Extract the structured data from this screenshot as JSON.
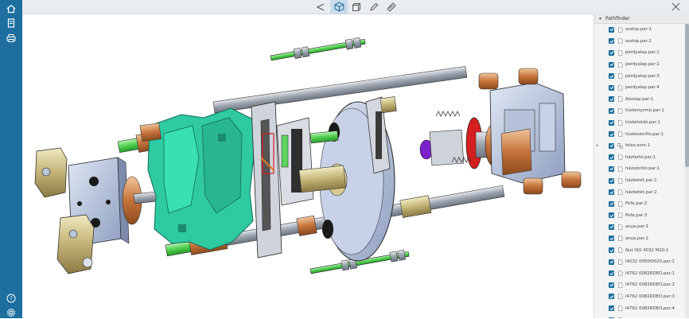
{
  "toolbar": {
    "icons": [
      "select-icon",
      "3d-view-icon",
      "cube-icon",
      "pen-icon",
      "measure-icon"
    ],
    "active": "3d-view-icon",
    "close_icon": "close-icon"
  },
  "sidebar": {
    "top_icons": [
      "home-icon",
      "document-icon",
      "printer-icon"
    ],
    "bottom_icons": [
      "help-icon",
      "settings-icon"
    ]
  },
  "zoom": {
    "level": 0.1
  },
  "pathfinder": {
    "title": "Pathfinder",
    "items": [
      {
        "label": "oszlop.par:1",
        "type": "part"
      },
      {
        "label": "oszlop.par:2",
        "type": "part"
      },
      {
        "label": "perdyalap.par:1",
        "type": "part"
      },
      {
        "label": "perdyalap.par:2",
        "type": "part"
      },
      {
        "label": "perdyalap.par:3",
        "type": "part"
      },
      {
        "label": "perdyalap.par:4",
        "type": "part"
      },
      {
        "label": "Alsolap.par:1",
        "type": "part"
      },
      {
        "label": "tüskenyomó.par:1",
        "type": "part"
      },
      {
        "label": "tüsketoldó.par:1",
        "type": "part"
      },
      {
        "label": "tüskeszorító.par:1",
        "type": "part"
      },
      {
        "label": "felso.asm:1",
        "type": "asm"
      },
      {
        "label": "házfartó.par:1",
        "type": "part"
      },
      {
        "label": "házszorító.par:1",
        "type": "part"
      },
      {
        "label": "házbetét.par:1",
        "type": "part"
      },
      {
        "label": "házbetét.par:2",
        "type": "part"
      },
      {
        "label": "Pofa.par:2",
        "type": "part"
      },
      {
        "label": "Pofa.par:3",
        "type": "part"
      },
      {
        "label": "anya.par:1",
        "type": "part"
      },
      {
        "label": "anya.par:2",
        "type": "part"
      },
      {
        "label": "Nut ISO 4032 M20:1",
        "type": "part"
      },
      {
        "label": "I4032 0050I0020.par:1",
        "type": "part"
      },
      {
        "label": "I4762 0082RDEO.par:1",
        "type": "part"
      },
      {
        "label": "I4762 0082RDEO.par:2",
        "type": "part"
      },
      {
        "label": "I4762 0082RDEO.par:3",
        "type": "part"
      },
      {
        "label": "I4762 0082RDEO.par:4",
        "type": "part"
      },
      {
        "label": "",
        "type": "part"
      }
    ]
  },
  "colors": {
    "accent": "#1e6f9f",
    "teal": "#2bbf9a",
    "steel": "#aebfdc",
    "copper": "#c9743a",
    "brass": "#bfb070",
    "green_rod": "#5fd45f",
    "red": "#d42020"
  }
}
